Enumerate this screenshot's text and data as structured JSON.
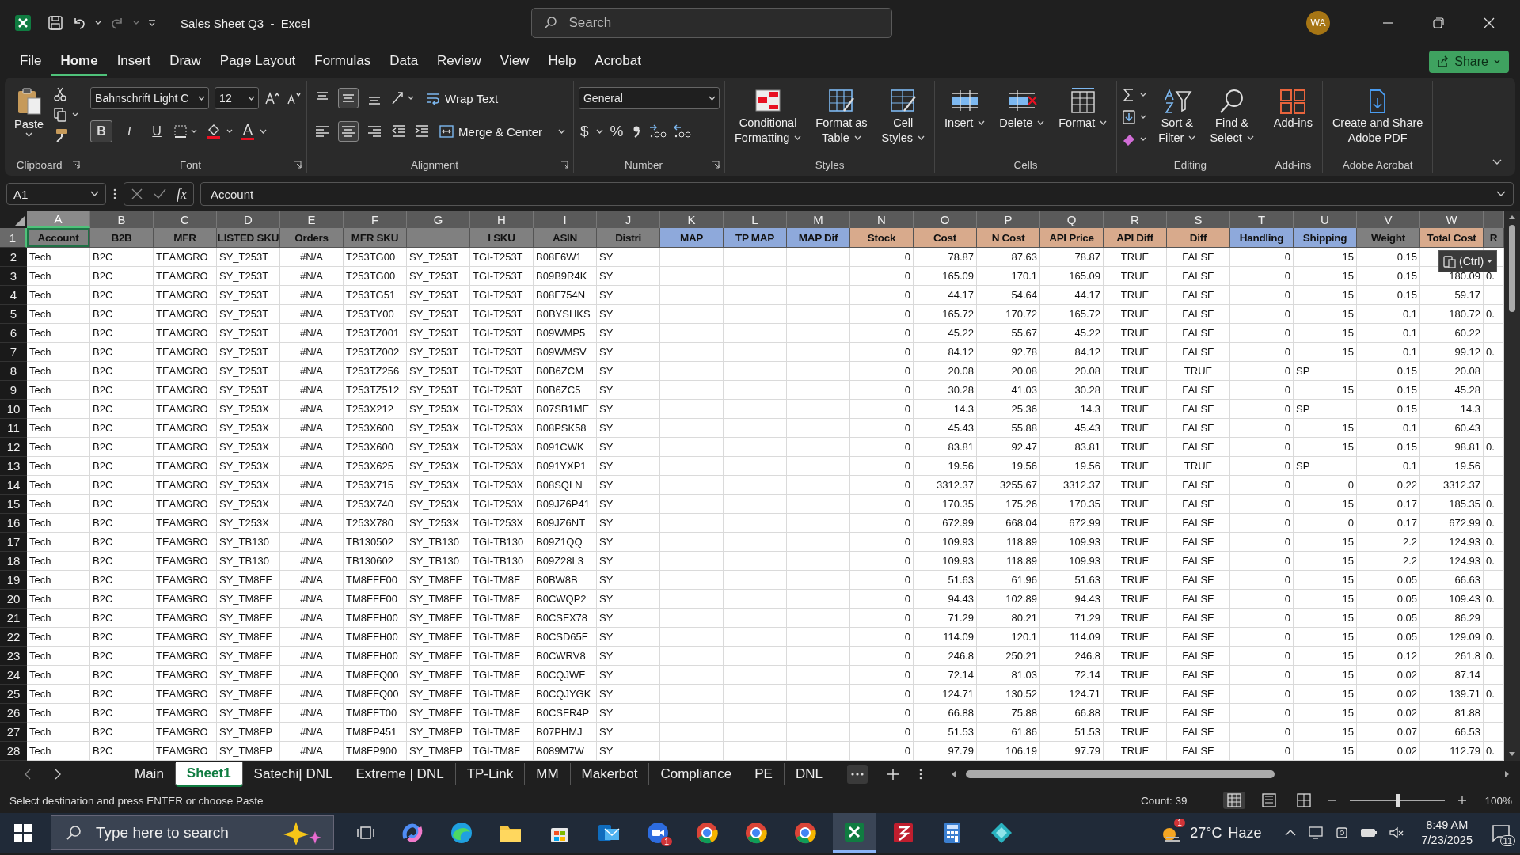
{
  "window": {
    "title": "Sales Sheet Q3  -  Excel",
    "search_placeholder": "Search",
    "avatar": "WA"
  },
  "menu": [
    {
      "label": "File",
      "selected": false
    },
    {
      "label": "Home",
      "selected": true
    },
    {
      "label": "Insert",
      "selected": false
    },
    {
      "label": "Draw",
      "selected": false
    },
    {
      "label": "Page Layout",
      "selected": false
    },
    {
      "label": "Formulas",
      "selected": false
    },
    {
      "label": "Data",
      "selected": false
    },
    {
      "label": "Review",
      "selected": false
    },
    {
      "label": "View",
      "selected": false
    },
    {
      "label": "Help",
      "selected": false
    },
    {
      "label": "Acrobat",
      "selected": false
    }
  ],
  "share": "Share",
  "ribbon": [
    {
      "kind": "clipboard",
      "label": "Clipboard",
      "paste": "Paste"
    },
    {
      "kind": "font",
      "label": "Font",
      "family": "Bahnschrift Light C",
      "size": "12",
      "toggles": [
        {
          "kind": "bold",
          "label": "B",
          "selected": true
        },
        {
          "kind": "italic",
          "label": "I",
          "selected": false
        },
        {
          "kind": "underline",
          "label": "U",
          "selected": false
        }
      ],
      "font_color": "A"
    },
    {
      "kind": "alignment",
      "label": "Alignment",
      "wrap": "Wrap Text",
      "merge": "Merge & Center",
      "valign": [
        {
          "selected": false
        },
        {
          "selected": true
        },
        {
          "selected": false
        }
      ],
      "halign": [
        {
          "selected": false
        },
        {
          "selected": true
        },
        {
          "selected": false
        }
      ]
    },
    {
      "kind": "number",
      "label": "Number",
      "format": "General",
      "currency": "$",
      "percent": "%"
    },
    {
      "kind": "styles",
      "label": "Styles",
      "buttons": [
        {
          "lines": [
            "Conditional",
            "Formatting"
          ]
        },
        {
          "lines": [
            "Format as",
            "Table"
          ]
        },
        {
          "lines": [
            "Cell",
            "Styles"
          ]
        }
      ]
    },
    {
      "kind": "cells",
      "label": "Cells",
      "buttons": [
        {
          "lines": [
            "Insert"
          ]
        },
        {
          "lines": [
            "Delete"
          ]
        },
        {
          "lines": [
            "Format"
          ]
        }
      ]
    },
    {
      "kind": "editing",
      "label": "Editing",
      "buttons": [
        {
          "lines": [
            "Sort &",
            "Filter"
          ]
        },
        {
          "lines": [
            "Find &",
            "Select"
          ]
        }
      ]
    },
    {
      "kind": "addins",
      "label": "Add-ins",
      "buttons": [
        {
          "lines": [
            "Add-ins"
          ]
        }
      ]
    },
    {
      "kind": "acrobat",
      "label": "Adobe Acrobat",
      "buttons": [
        {
          "lines": [
            "Create and Share",
            "Adobe PDF"
          ]
        }
      ]
    }
  ],
  "formula_bar": {
    "name_box": "A1",
    "function_label": "fx",
    "value": "Account"
  },
  "columns": [
    {
      "letter": "A",
      "header": "Account",
      "color": "#808080",
      "selected": true
    },
    {
      "letter": "B",
      "header": "B2B",
      "color": "#808080",
      "selected": false
    },
    {
      "letter": "C",
      "header": "MFR",
      "color": "#808080",
      "selected": false
    },
    {
      "letter": "D",
      "header": "LISTED SKU",
      "color": "#808080",
      "selected": false
    },
    {
      "letter": "E",
      "header": "Orders",
      "color": "#808080",
      "selected": false
    },
    {
      "letter": "F",
      "header": "MFR SKU",
      "color": "#808080",
      "selected": false
    },
    {
      "letter": "G",
      "color": "#808080",
      "selected": false
    },
    {
      "letter": "H",
      "header": "I SKU",
      "color": "#808080",
      "selected": false
    },
    {
      "letter": "I",
      "header": "ASIN",
      "color": "#808080",
      "selected": false
    },
    {
      "letter": "J",
      "header": "Distri",
      "color": "#808080",
      "selected": false
    },
    {
      "letter": "K",
      "header": "MAP",
      "color": "#8ea9db",
      "selected": false
    },
    {
      "letter": "L",
      "header": "TP MAP",
      "color": "#8ea9db",
      "selected": false
    },
    {
      "letter": "M",
      "header": "MAP Dif",
      "color": "#8ea9db",
      "selected": false
    },
    {
      "letter": "N",
      "header": "Stock",
      "color": "#d8aa8c",
      "selected": false
    },
    {
      "letter": "O",
      "header": "Cost",
      "color": "#d8aa8c",
      "selected": false
    },
    {
      "letter": "P",
      "header": "N Cost",
      "color": "#d8aa8c",
      "selected": false
    },
    {
      "letter": "Q",
      "header": "API Price",
      "color": "#d8aa8c",
      "selected": false
    },
    {
      "letter": "R",
      "header": "API Diff",
      "color": "#d8aa8c",
      "selected": false
    },
    {
      "letter": "S",
      "header": "Diff",
      "color": "#d8aa8c",
      "selected": false
    },
    {
      "letter": "T",
      "header": "Handling",
      "color": "#8ea9db",
      "selected": false
    },
    {
      "letter": "U",
      "header": "Shipping",
      "color": "#8ea9db",
      "selected": false
    },
    {
      "letter": "V",
      "header": "Weight",
      "color": "#808080",
      "selected": false
    },
    {
      "letter": "W",
      "header": "Total Cost",
      "color": "#d8aa8c",
      "selected": false
    },
    {
      "header": "R",
      "color": "#808080",
      "selected": false
    }
  ],
  "header_row": {
    "number": "1",
    "selected": true
  },
  "rows": [
    {
      "number": "2",
      "selected": false,
      "cells": [
        "Tech",
        "B2C",
        "TEAMGRO",
        "SY_T253T",
        "#N/A",
        "T253TG00",
        "SY_T253T",
        "TGI-T253T",
        "B08F6W1",
        "SY",
        null,
        null,
        null,
        "0",
        "78.87",
        "87.63",
        "78.87",
        "TRUE",
        "FALSE",
        "0",
        "15",
        "0.15",
        null,
        null
      ]
    },
    {
      "number": "3",
      "selected": false,
      "cells": [
        "Tech",
        "B2C",
        "TEAMGRO",
        "SY_T253T",
        "#N/A",
        "T253TG00",
        "SY_T253T",
        "TGI-T253T",
        "B09B9R4K",
        "SY",
        null,
        null,
        null,
        "0",
        "165.09",
        "170.1",
        "165.09",
        "TRUE",
        "FALSE",
        "0",
        "15",
        "0.15",
        "180.09",
        "0."
      ]
    },
    {
      "number": "4",
      "selected": false,
      "cells": [
        "Tech",
        "B2C",
        "TEAMGRO",
        "SY_T253T",
        "#N/A",
        "T253TG51",
        "SY_T253T",
        "TGI-T253T",
        "B08F754N",
        "SY",
        null,
        null,
        null,
        "0",
        "44.17",
        "54.64",
        "44.17",
        "TRUE",
        "FALSE",
        "0",
        "15",
        "0.15",
        "59.17",
        null
      ]
    },
    {
      "number": "5",
      "selected": false,
      "cells": [
        "Tech",
        "B2C",
        "TEAMGRO",
        "SY_T253T",
        "#N/A",
        "T253TY00",
        "SY_T253T",
        "TGI-T253T",
        "B0BYSHKS",
        "SY",
        null,
        null,
        null,
        "0",
        "165.72",
        "170.72",
        "165.72",
        "TRUE",
        "FALSE",
        "0",
        "15",
        "0.1",
        "180.72",
        "0."
      ]
    },
    {
      "number": "6",
      "selected": false,
      "cells": [
        "Tech",
        "B2C",
        "TEAMGRO",
        "SY_T253T",
        "#N/A",
        "T253TZ001",
        "SY_T253T",
        "TGI-T253T",
        "B09WMP5",
        "SY",
        null,
        null,
        null,
        "0",
        "45.22",
        "55.67",
        "45.22",
        "TRUE",
        "FALSE",
        "0",
        "15",
        "0.1",
        "60.22",
        null
      ]
    },
    {
      "number": "7",
      "selected": false,
      "cells": [
        "Tech",
        "B2C",
        "TEAMGRO",
        "SY_T253T",
        "#N/A",
        "T253TZ002",
        "SY_T253T",
        "TGI-T253T",
        "B09WMSV",
        "SY",
        null,
        null,
        null,
        "0",
        "84.12",
        "92.78",
        "84.12",
        "TRUE",
        "FALSE",
        "0",
        "15",
        "0.1",
        "99.12",
        "0."
      ]
    },
    {
      "number": "8",
      "selected": false,
      "cells": [
        "Tech",
        "B2C",
        "TEAMGRO",
        "SY_T253T",
        "#N/A",
        "T253TZ256",
        "SY_T253T",
        "TGI-T253T",
        "B0B6ZCM",
        "SY",
        null,
        null,
        null,
        "0",
        "20.08",
        "20.08",
        "20.08",
        "TRUE",
        "TRUE",
        "0",
        "SP",
        "0.15",
        "20.08",
        null
      ]
    },
    {
      "number": "9",
      "selected": false,
      "cells": [
        "Tech",
        "B2C",
        "TEAMGRO",
        "SY_T253T",
        "#N/A",
        "T253TZ512",
        "SY_T253T",
        "TGI-T253T",
        "B0B6ZC5",
        "SY",
        null,
        null,
        null,
        "0",
        "30.28",
        "41.03",
        "30.28",
        "TRUE",
        "FALSE",
        "0",
        "15",
        "0.15",
        "45.28",
        null
      ]
    },
    {
      "number": "10",
      "selected": false,
      "cells": [
        "Tech",
        "B2C",
        "TEAMGRO",
        "SY_T253X",
        "#N/A",
        "T253X212",
        "SY_T253X",
        "TGI-T253X",
        "B07SB1ME",
        "SY",
        null,
        null,
        null,
        "0",
        "14.3",
        "25.36",
        "14.3",
        "TRUE",
        "FALSE",
        "0",
        "SP",
        "0.15",
        "14.3",
        null
      ]
    },
    {
      "number": "11",
      "selected": false,
      "cells": [
        "Tech",
        "B2C",
        "TEAMGRO",
        "SY_T253X",
        "#N/A",
        "T253X600",
        "SY_T253X",
        "TGI-T253X",
        "B08PSK58",
        "SY",
        null,
        null,
        null,
        "0",
        "45.43",
        "55.88",
        "45.43",
        "TRUE",
        "FALSE",
        "0",
        "15",
        "0.1",
        "60.43",
        null
      ]
    },
    {
      "number": "12",
      "selected": false,
      "cells": [
        "Tech",
        "B2C",
        "TEAMGRO",
        "SY_T253X",
        "#N/A",
        "T253X600",
        "SY_T253X",
        "TGI-T253X",
        "B091CWK",
        "SY",
        null,
        null,
        null,
        "0",
        "83.81",
        "92.47",
        "83.81",
        "TRUE",
        "FALSE",
        "0",
        "15",
        "0.15",
        "98.81",
        "0."
      ]
    },
    {
      "number": "13",
      "selected": false,
      "cells": [
        "Tech",
        "B2C",
        "TEAMGRO",
        "SY_T253X",
        "#N/A",
        "T253X625",
        "SY_T253X",
        "TGI-T253X",
        "B091YXP1",
        "SY",
        null,
        null,
        null,
        "0",
        "19.56",
        "19.56",
        "19.56",
        "TRUE",
        "TRUE",
        "0",
        "SP",
        "0.1",
        "19.56",
        null
      ]
    },
    {
      "number": "14",
      "selected": false,
      "cells": [
        "Tech",
        "B2C",
        "TEAMGRO",
        "SY_T253X",
        "#N/A",
        "T253X715",
        "SY_T253X",
        "TGI-T253X",
        "B08SQLN",
        "SY",
        null,
        null,
        null,
        "0",
        "3312.37",
        "3255.67",
        "3312.37",
        "TRUE",
        "FALSE",
        "0",
        "0",
        "0.22",
        "3312.37",
        null
      ]
    },
    {
      "number": "15",
      "selected": false,
      "cells": [
        "Tech",
        "B2C",
        "TEAMGRO",
        "SY_T253X",
        "#N/A",
        "T253X740",
        "SY_T253X",
        "TGI-T253X",
        "B09JZ6P41",
        "SY",
        null,
        null,
        null,
        "0",
        "170.35",
        "175.26",
        "170.35",
        "TRUE",
        "FALSE",
        "0",
        "15",
        "0.17",
        "185.35",
        "0."
      ]
    },
    {
      "number": "16",
      "selected": false,
      "cells": [
        "Tech",
        "B2C",
        "TEAMGRO",
        "SY_T253X",
        "#N/A",
        "T253X780",
        "SY_T253X",
        "TGI-T253X",
        "B09JZ6NT",
        "SY",
        null,
        null,
        null,
        "0",
        "672.99",
        "668.04",
        "672.99",
        "TRUE",
        "FALSE",
        "0",
        "0",
        "0.17",
        "672.99",
        "0."
      ]
    },
    {
      "number": "17",
      "selected": false,
      "cells": [
        "Tech",
        "B2C",
        "TEAMGRO",
        "SY_TB130",
        "#N/A",
        "TB130502",
        "SY_TB130",
        "TGI-TB130",
        "B09Z1QQ",
        "SY",
        null,
        null,
        null,
        "0",
        "109.93",
        "118.89",
        "109.93",
        "TRUE",
        "FALSE",
        "0",
        "15",
        "2.2",
        "124.93",
        "0."
      ]
    },
    {
      "number": "18",
      "selected": false,
      "cells": [
        "Tech",
        "B2C",
        "TEAMGRO",
        "SY_TB130",
        "#N/A",
        "TB130602",
        "SY_TB130",
        "TGI-TB130",
        "B09Z28L3",
        "SY",
        null,
        null,
        null,
        "0",
        "109.93",
        "118.89",
        "109.93",
        "TRUE",
        "FALSE",
        "0",
        "15",
        "2.2",
        "124.93",
        "0."
      ]
    },
    {
      "number": "19",
      "selected": false,
      "cells": [
        "Tech",
        "B2C",
        "TEAMGRO",
        "SY_TM8FF",
        "#N/A",
        "TM8FFE00",
        "SY_TM8FF",
        "TGI-TM8F",
        "B0BW8B",
        "SY",
        null,
        null,
        null,
        "0",
        "51.63",
        "61.96",
        "51.63",
        "TRUE",
        "FALSE",
        "0",
        "15",
        "0.05",
        "66.63",
        null
      ]
    },
    {
      "number": "20",
      "selected": false,
      "cells": [
        "Tech",
        "B2C",
        "TEAMGRO",
        "SY_TM8FF",
        "#N/A",
        "TM8FFE00",
        "SY_TM8FF",
        "TGI-TM8F",
        "B0CWQP2",
        "SY",
        null,
        null,
        null,
        "0",
        "94.43",
        "102.89",
        "94.43",
        "TRUE",
        "FALSE",
        "0",
        "15",
        "0.05",
        "109.43",
        "0."
      ]
    },
    {
      "number": "21",
      "selected": false,
      "cells": [
        "Tech",
        "B2C",
        "TEAMGRO",
        "SY_TM8FF",
        "#N/A",
        "TM8FFH00",
        "SY_TM8FF",
        "TGI-TM8F",
        "B0CSFX78",
        "SY",
        null,
        null,
        null,
        "0",
        "71.29",
        "80.21",
        "71.29",
        "TRUE",
        "FALSE",
        "0",
        "15",
        "0.05",
        "86.29",
        null
      ]
    },
    {
      "number": "22",
      "selected": false,
      "cells": [
        "Tech",
        "B2C",
        "TEAMGRO",
        "SY_TM8FF",
        "#N/A",
        "TM8FFH00",
        "SY_TM8FF",
        "TGI-TM8F",
        "B0CSD65F",
        "SY",
        null,
        null,
        null,
        "0",
        "114.09",
        "120.1",
        "114.09",
        "TRUE",
        "FALSE",
        "0",
        "15",
        "0.05",
        "129.09",
        "0."
      ]
    },
    {
      "number": "23",
      "selected": false,
      "cells": [
        "Tech",
        "B2C",
        "TEAMGRO",
        "SY_TM8FF",
        "#N/A",
        "TM8FFH00",
        "SY_TM8FF",
        "TGI-TM8F",
        "B0CWRV8",
        "SY",
        null,
        null,
        null,
        "0",
        "246.8",
        "250.21",
        "246.8",
        "TRUE",
        "FALSE",
        "0",
        "15",
        "0.12",
        "261.8",
        "0."
      ]
    },
    {
      "number": "24",
      "selected": false,
      "cells": [
        "Tech",
        "B2C",
        "TEAMGRO",
        "SY_TM8FF",
        "#N/A",
        "TM8FFQ00",
        "SY_TM8FF",
        "TGI-TM8F",
        "B0CQJWF",
        "SY",
        null,
        null,
        null,
        "0",
        "72.14",
        "81.03",
        "72.14",
        "TRUE",
        "FALSE",
        "0",
        "15",
        "0.02",
        "87.14",
        null
      ]
    },
    {
      "number": "25",
      "selected": false,
      "cells": [
        "Tech",
        "B2C",
        "TEAMGRO",
        "SY_TM8FF",
        "#N/A",
        "TM8FFQ00",
        "SY_TM8FF",
        "TGI-TM8F",
        "B0CQJYGK",
        "SY",
        null,
        null,
        null,
        "0",
        "124.71",
        "130.52",
        "124.71",
        "TRUE",
        "FALSE",
        "0",
        "15",
        "0.02",
        "139.71",
        "0."
      ]
    },
    {
      "number": "26",
      "selected": false,
      "cells": [
        "Tech",
        "B2C",
        "TEAMGRO",
        "SY_TM8FF",
        "#N/A",
        "TM8FFT00",
        "SY_TM8FF",
        "TGI-TM8F",
        "B0CSFR4P",
        "SY",
        null,
        null,
        null,
        "0",
        "66.88",
        "75.88",
        "66.88",
        "TRUE",
        "FALSE",
        "0",
        "15",
        "0.02",
        "81.88",
        null
      ]
    },
    {
      "number": "27",
      "selected": false,
      "cells": [
        "Tech",
        "B2C",
        "TEAMGRO",
        "SY_TM8FP",
        "#N/A",
        "TM8FP451",
        "SY_TM8FP",
        "TGI-TM8F",
        "B07PHMJ",
        "SY",
        null,
        null,
        null,
        "0",
        "51.53",
        "61.86",
        "51.53",
        "TRUE",
        "FALSE",
        "0",
        "15",
        "0.07",
        "66.53",
        null
      ]
    },
    {
      "number": "28",
      "selected": false,
      "cells": [
        "Tech",
        "B2C",
        "TEAMGRO",
        "SY_TM8FP",
        "#N/A",
        "TM8FP900",
        "SY_TM8FP",
        "TGI-TM8F",
        "B089M7W",
        "SY",
        null,
        null,
        null,
        "0",
        "97.79",
        "106.19",
        "97.79",
        "TRUE",
        "FALSE",
        "0",
        "15",
        "0.02",
        "112.79",
        "0."
      ]
    }
  ],
  "paste_options": "(Ctrl)",
  "sheets": [
    {
      "label": "Main",
      "selected": false
    },
    {
      "label": "Sheet1",
      "selected": true
    },
    {
      "label": "Satechi| DNL",
      "selected": false
    },
    {
      "label": "Extreme | DNL",
      "selected": false
    },
    {
      "label": "TP-Link",
      "selected": false
    },
    {
      "label": "MM",
      "selected": false
    },
    {
      "label": "Makerbot",
      "selected": false
    },
    {
      "label": "Compliance",
      "selected": false
    },
    {
      "label": "PE",
      "selected": false
    },
    {
      "label": "DNL",
      "selected": false
    }
  ],
  "status": {
    "message": "Select destination and press ENTER or choose Paste",
    "count": "Count: 39",
    "views": [
      {
        "selected": true
      },
      {
        "selected": false
      },
      {
        "selected": false
      }
    ],
    "zoom": {
      "level": 0.5,
      "reading": "100%"
    }
  },
  "taskbar": {
    "search_placeholder": "Type here to search",
    "apps": [
      {
        "selected": false
      },
      {
        "selected": false
      },
      {
        "selected": false
      },
      {
        "selected": false
      },
      {
        "selected": false
      },
      {
        "selected": false,
        "badge": "1"
      },
      {
        "selected": false
      },
      {
        "selected": false
      },
      {
        "selected": false
      },
      {
        "selected": true
      },
      {
        "selected": false
      },
      {
        "selected": false
      },
      {
        "selected": false
      }
    ],
    "weather_badge": "1",
    "temperature": "27°C",
    "condition": "Haze",
    "time": "8:49 AM",
    "date": "7/23/2025",
    "notifications": "11"
  }
}
